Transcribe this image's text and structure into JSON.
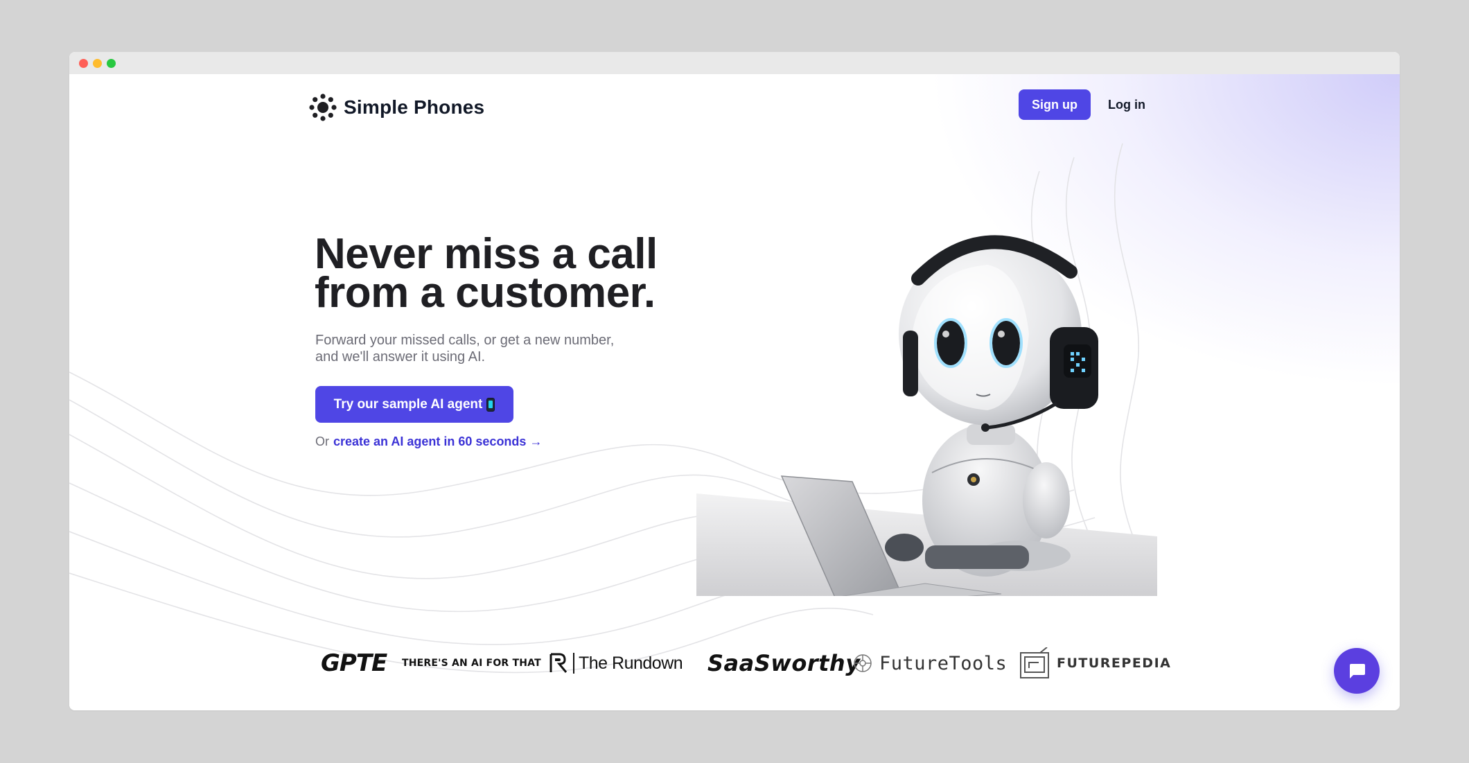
{
  "window": {
    "controls": [
      "close",
      "minimize",
      "maximize"
    ]
  },
  "header": {
    "brand_icon": "sunburst-logo-icon",
    "brand_name": "Simple Phones",
    "signup_label": "Sign up",
    "login_label": "Log in"
  },
  "hero": {
    "title_line1": "Never miss a call",
    "title_line2": "from a customer.",
    "subtitle_line1": "Forward your missed calls, or get a new number,",
    "subtitle_line2": "and we'll answer it using AI.",
    "cta_label": "Try our sample AI agent",
    "cta_icon": "mobile-phone-icon",
    "alt_prefix": "Or",
    "alt_link": "create an AI agent in 60 seconds →"
  },
  "illustration": {
    "subject": "robot-with-headset-at-laptop"
  },
  "press_logos": [
    {
      "name": "GPTE"
    },
    {
      "name": "THERE'S AN AI FOR THAT"
    },
    {
      "name": "The Rundown"
    },
    {
      "name": "SaaSworthy"
    },
    {
      "name": "FutureTools"
    },
    {
      "name": "FUTUREPEDIA"
    }
  ],
  "chat": {
    "icon": "chat-bubble-icon"
  },
  "colors": {
    "accent": "#4f46e5",
    "heading": "#1f1f23",
    "muted": "#6b6b75",
    "link": "#3b32d6",
    "page_bg": "#d4d4d4"
  }
}
